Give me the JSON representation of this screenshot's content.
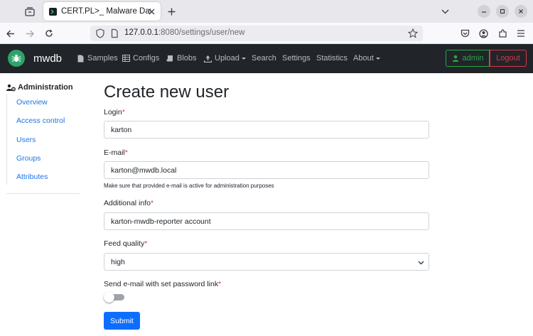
{
  "browser": {
    "tab_title": "CERT.PL>_ Malware Data",
    "url_host": "127.0.0.1",
    "url_rest": ":8080/settings/user/new"
  },
  "app": {
    "brand": "mwdb",
    "nav": [
      {
        "label": "Samples",
        "icon": "file-icon"
      },
      {
        "label": "Configs",
        "icon": "table-icon"
      },
      {
        "label": "Blobs",
        "icon": "scroll-icon"
      },
      {
        "label": "Upload",
        "icon": "upload-icon",
        "dropdown": true
      },
      {
        "label": "Search"
      },
      {
        "label": "Settings"
      },
      {
        "label": "Statistics"
      },
      {
        "label": "About",
        "dropdown": true
      }
    ],
    "user_label": "admin",
    "logout_label": "Logout"
  },
  "sidebar": {
    "heading": "Administration",
    "items": [
      "Overview",
      "Access control",
      "Users",
      "Groups",
      "Attributes"
    ]
  },
  "form": {
    "title": "Create new user",
    "login_label": "Login",
    "login_value": "karton",
    "email_label": "E-mail",
    "email_value": "karton@mwdb.local",
    "email_help": "Make sure that provided e-mail is active for administration purposes",
    "info_label": "Additional info",
    "info_value": "karton-mwdb-reporter account",
    "feed_label": "Feed quality",
    "feed_value": "high",
    "send_email_label": "Send e-mail with set password link",
    "send_email_on": false,
    "required_mark": "*",
    "submit_label": "Submit"
  },
  "colors": {
    "navbar_bg": "#212529",
    "link": "#1f74e6",
    "primary": "#0d6efd",
    "success": "#28a745",
    "danger": "#dc3545"
  }
}
